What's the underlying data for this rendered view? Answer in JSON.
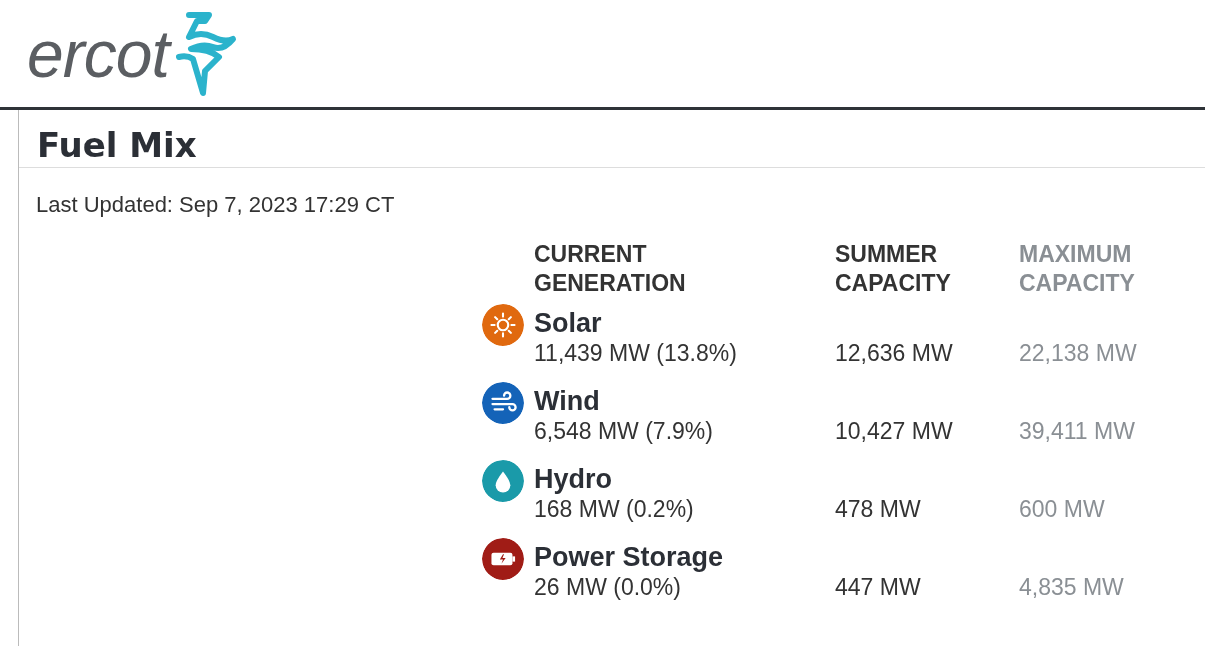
{
  "logo": {
    "text": "ercot"
  },
  "page": {
    "title": "Fuel Mix",
    "last_updated": "Last Updated: Sep 7, 2023 17:29 CT"
  },
  "table": {
    "columns": [
      "CURRENT GENERATION",
      "SUMMER CAPACITY",
      "MAXIMUM CAPACITY"
    ],
    "rows": [
      {
        "kind": "solar",
        "color": "#e0690f",
        "name": "Solar",
        "generation": "11,439 MW (13.8%)",
        "summer_capacity": "12,636 MW",
        "maximum_capacity": "22,138 MW"
      },
      {
        "kind": "wind",
        "color": "#1463b8",
        "name": "Wind",
        "generation": "6,548 MW (7.9%)",
        "summer_capacity": "10,427 MW",
        "maximum_capacity": "39,411 MW"
      },
      {
        "kind": "hydro",
        "color": "#1a9aa9",
        "name": "Hydro",
        "generation": "168 MW (0.2%)",
        "summer_capacity": "478 MW",
        "maximum_capacity": "600 MW"
      },
      {
        "kind": "battery",
        "color": "#a01c16",
        "name": "Power Storage",
        "generation": "26 MW (0.0%)",
        "summer_capacity": "447 MW",
        "maximum_capacity": "4,835 MW"
      }
    ]
  }
}
